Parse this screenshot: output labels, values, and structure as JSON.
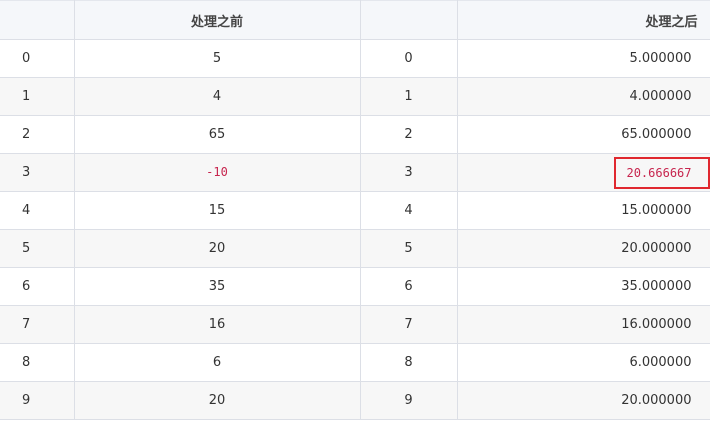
{
  "headers": {
    "index_before": "",
    "before": "处理之前",
    "index_after": "",
    "after": "处理之后"
  },
  "rows": [
    {
      "i": "0",
      "before": "5",
      "j": "0",
      "after": "5.000000"
    },
    {
      "i": "1",
      "before": "4",
      "j": "1",
      "after": "4.000000"
    },
    {
      "i": "2",
      "before": "65",
      "j": "2",
      "after": "65.000000"
    },
    {
      "i": "3",
      "before": "-10",
      "j": "3",
      "after": "20.666667"
    },
    {
      "i": "4",
      "before": "15",
      "j": "4",
      "after": "15.000000"
    },
    {
      "i": "5",
      "before": "20",
      "j": "5",
      "after": "20.000000"
    },
    {
      "i": "6",
      "before": "35",
      "j": "6",
      "after": "35.000000"
    },
    {
      "i": "7",
      "before": "16",
      "j": "7",
      "after": "16.000000"
    },
    {
      "i": "8",
      "before": "6",
      "j": "8",
      "after": "6.000000"
    },
    {
      "i": "9",
      "before": "20",
      "j": "9",
      "after": "20.000000"
    }
  ],
  "highlight": {
    "row": 3,
    "before_color": "#c7254e",
    "after_box_color": "#e0282f"
  }
}
